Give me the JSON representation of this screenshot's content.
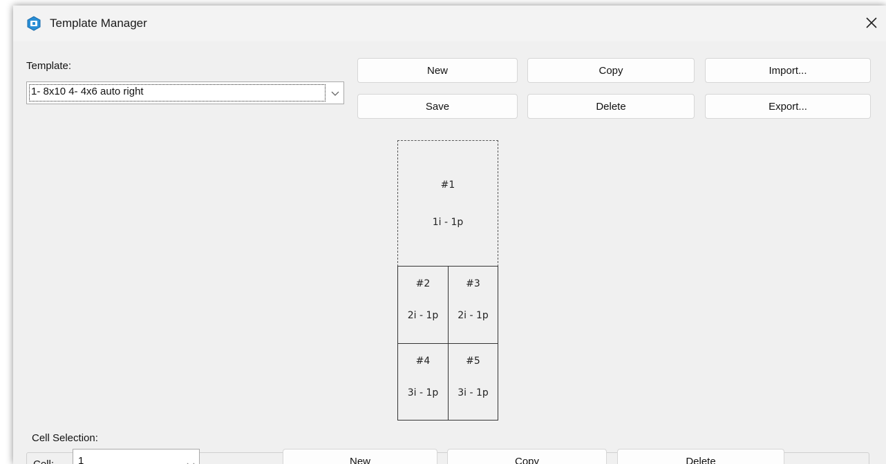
{
  "window": {
    "title": "Template Manager"
  },
  "template": {
    "label": "Template:",
    "selected": "1- 8x10 4- 4x6 auto right",
    "buttons": {
      "new": "New",
      "copy": "Copy",
      "import": "Import...",
      "save": "Save",
      "delete": "Delete",
      "export": "Export..."
    }
  },
  "layout": {
    "cells": [
      {
        "num": "#1",
        "info": "1i - 1p"
      },
      {
        "num": "#2",
        "info": "2i - 1p"
      },
      {
        "num": "#3",
        "info": "2i - 1p"
      },
      {
        "num": "#4",
        "info": "3i - 1p"
      },
      {
        "num": "#5",
        "info": "3i - 1p"
      }
    ]
  },
  "cell_selection": {
    "label": "Cell Selection:",
    "cell_label": "Cell:",
    "cell_value": "1",
    "buttons": {
      "new": "New",
      "copy": "Copy",
      "delete": "Delete"
    }
  },
  "icons": {
    "app": "app-icon",
    "close": "close-icon",
    "dropdown": "chevron-down-icon"
  }
}
